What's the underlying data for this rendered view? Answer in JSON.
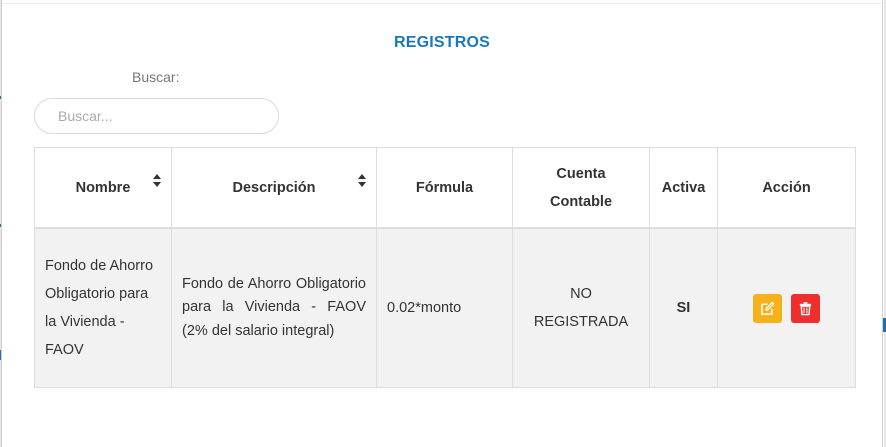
{
  "title": "REGISTROS",
  "search": {
    "label": "Buscar:",
    "placeholder": "Buscar...",
    "value": ""
  },
  "table": {
    "headers": {
      "nombre": "Nombre",
      "descripcion": "Descripción",
      "formula": "Fórmula",
      "cuenta_line1": "Cuenta",
      "cuenta_line2": "Contable",
      "activa": "Activa",
      "accion": "Acción"
    },
    "rows": [
      {
        "nombre": "Fondo de Ahorro Obligatorio para la Vivienda - FAOV",
        "descripcion": "Fondo de Ahorro Obligatorio para la Vivienda - FAOV (2% del salario integral)",
        "formula": "0.02*monto",
        "cuenta_line1": "NO",
        "cuenta_line2": "REGISTRADA",
        "activa": "SI"
      }
    ]
  },
  "colors": {
    "title": "#1878bf",
    "active": "#2fc22f",
    "edit_button": "#f7b21b",
    "delete_button": "#ef2f2f",
    "row_background": "#f2f2f2"
  },
  "icons": {
    "edit": "pencil-square-icon",
    "delete": "trash-icon",
    "sort": "sort-icon"
  }
}
